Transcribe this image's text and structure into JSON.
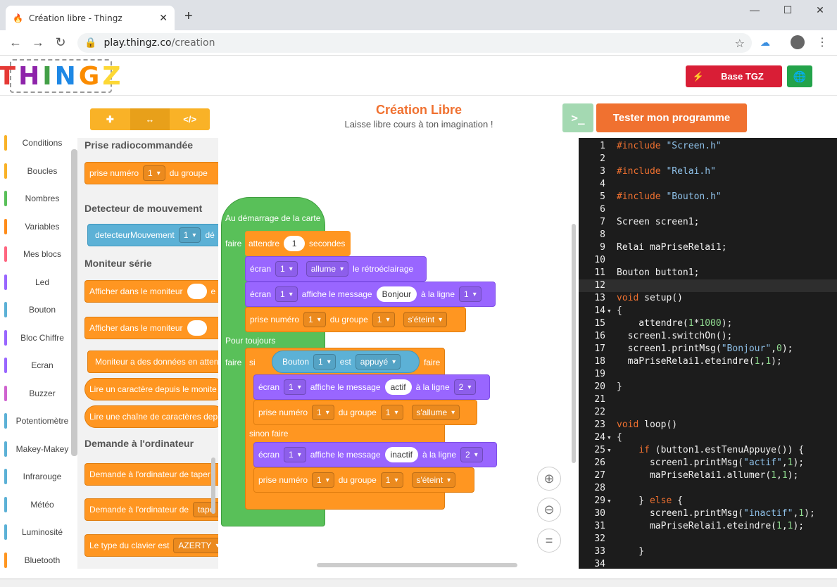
{
  "browser": {
    "tab_title": "Création libre - Thingz",
    "url_domain": "play.thingz.co",
    "url_path": "/creation",
    "new_tab": "+"
  },
  "header": {
    "logo": "THINGZ",
    "base_button": "Base TGZ"
  },
  "toolbar": {
    "title": "Création Libre",
    "subtitle": "Laisse libre cours à ton imagination !",
    "test_button": "Tester mon programme",
    "terminal_icon": ">_"
  },
  "categories": [
    {
      "label": "Conditions",
      "color": "#f9b227"
    },
    {
      "label": "Boucles",
      "color": "#f9b227"
    },
    {
      "label": "Nombres",
      "color": "#59c059"
    },
    {
      "label": "Variables",
      "color": "#ff8c1a"
    },
    {
      "label": "Mes blocs",
      "color": "#ff6680"
    },
    {
      "label": "Led",
      "color": "#9966ff"
    },
    {
      "label": "Bouton",
      "color": "#5cb1d6"
    },
    {
      "label": "Bloc Chiffre",
      "color": "#9966ff"
    },
    {
      "label": "Ecran",
      "color": "#9966ff"
    },
    {
      "label": "Buzzer",
      "color": "#cf63cf"
    },
    {
      "label": "Potentiomètre",
      "color": "#5cb1d6"
    },
    {
      "label": "Makey-Makey",
      "color": "#5cb1d6"
    },
    {
      "label": "Infrarouge",
      "color": "#5cb1d6"
    },
    {
      "label": "Météo",
      "color": "#5cb1d6"
    },
    {
      "label": "Luminosité",
      "color": "#5cb1d6"
    },
    {
      "label": "Bluetooth",
      "color": "#ff9621"
    }
  ],
  "flyout": {
    "h1": "Prise radiocommandée",
    "b1": "prise numéro",
    "b1dd": "1",
    "b1b": "du groupe",
    "h2": "Detecteur de mouvement",
    "b2": "detecteurMouvement",
    "b2dd": "1",
    "b2b": "dé",
    "h3": "Moniteur série",
    "b3": "Afficher dans le moniteur",
    "b3b": "e",
    "b4": "Afficher dans le moniteur",
    "b5": "Moniteur a des données en atten",
    "b6": "Lire un caractère depuis le monite",
    "b7": "Lire une chaîne de caractères dep",
    "h4": "Demande à l'ordinateur",
    "b8": "Demande à l'ordinateur de taper",
    "b9": "Demande à l'ordinateur de",
    "b9b": "tape",
    "b10": "Le type du clavier est",
    "b10dd": "AZERTY"
  },
  "workspace": {
    "start": "Au démarrage de la carte",
    "faire": "faire",
    "attendre": "attendre",
    "attendre_val": "1",
    "secondes": "secondes",
    "ecran": "écran",
    "one": "1",
    "two": "2",
    "allume": "allume",
    "retro": "le rétroéclairage",
    "affiche": "affiche le message",
    "bonjour": "Bonjour",
    "a_la_ligne": "à la ligne",
    "prise": "prise numéro",
    "du_groupe": "du groupe",
    "seteint": "s'éteint",
    "sallume": "s'allume",
    "pour_toujours": "Pour toujours",
    "si": "si",
    "bouton": "Bouton",
    "est": "est",
    "appuye": "appuyé",
    "actif": "actif",
    "inactif": "inactif",
    "sinon": "sinon faire"
  },
  "code": [
    {
      "n": "1",
      "t": "#include \"Screen.h\""
    },
    {
      "n": "2",
      "t": ""
    },
    {
      "n": "3",
      "t": "#include \"Relai.h\""
    },
    {
      "n": "4",
      "t": ""
    },
    {
      "n": "5",
      "t": "#include \"Bouton.h\""
    },
    {
      "n": "6",
      "t": ""
    },
    {
      "n": "7",
      "t": "Screen screen1;"
    },
    {
      "n": "8",
      "t": ""
    },
    {
      "n": "9",
      "t": "Relai maPriseRelai1;"
    },
    {
      "n": "10",
      "t": ""
    },
    {
      "n": "11",
      "t": "Bouton button1;"
    },
    {
      "n": "12",
      "t": ""
    },
    {
      "n": "13",
      "t": "void setup()"
    },
    {
      "n": "14",
      "t": "{"
    },
    {
      "n": "15",
      "t": "    attendre(1*1000);"
    },
    {
      "n": "16",
      "t": "  screen1.switchOn();"
    },
    {
      "n": "17",
      "t": "  screen1.printMsg(\"Bonjour\",0);"
    },
    {
      "n": "18",
      "t": "  maPriseRelai1.eteindre(1,1);"
    },
    {
      "n": "19",
      "t": ""
    },
    {
      "n": "20",
      "t": "}"
    },
    {
      "n": "21",
      "t": ""
    },
    {
      "n": "22",
      "t": ""
    },
    {
      "n": "23",
      "t": "void loop()"
    },
    {
      "n": "24",
      "t": "{"
    },
    {
      "n": "25",
      "t": "    if (button1.estTenuAppuye()) {"
    },
    {
      "n": "26",
      "t": "      screen1.printMsg(\"actif\",1);"
    },
    {
      "n": "27",
      "t": "      maPriseRelai1.allumer(1,1);"
    },
    {
      "n": "28",
      "t": ""
    },
    {
      "n": "29",
      "t": "    } else {"
    },
    {
      "n": "30",
      "t": "      screen1.printMsg(\"inactif\",1);"
    },
    {
      "n": "31",
      "t": "      maPriseRelai1.eteindre(1,1);"
    },
    {
      "n": "32",
      "t": ""
    },
    {
      "n": "33",
      "t": "    }"
    },
    {
      "n": "34",
      "t": ""
    }
  ]
}
